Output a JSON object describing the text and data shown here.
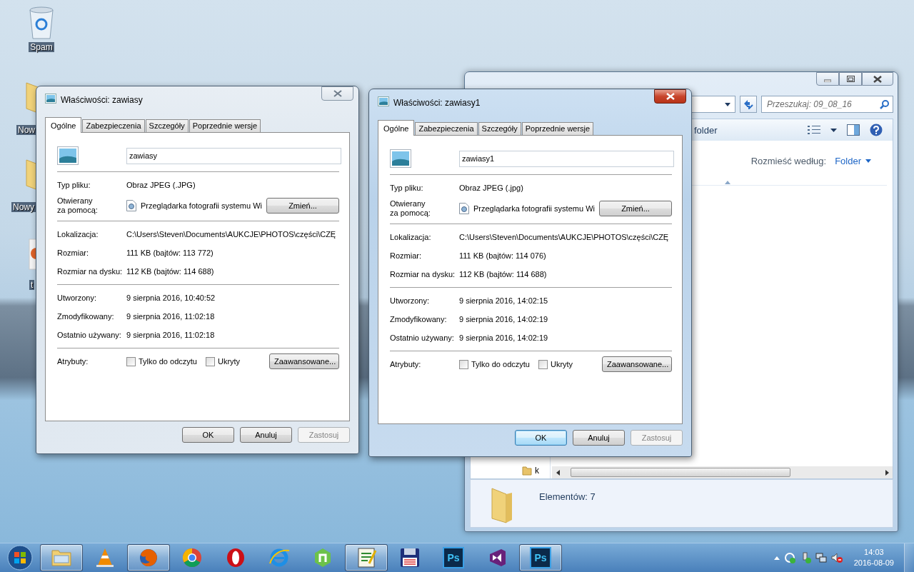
{
  "desktop_icons": [
    {
      "kind": "trash",
      "label": "Spam"
    },
    {
      "kind": "folder",
      "label": "Now"
    },
    {
      "kind": "folder",
      "label": "Nowy"
    },
    {
      "kind": "app",
      "label": "t"
    }
  ],
  "explorer": {
    "search": {
      "placeholder": "Przeszukaj: 09_08_16"
    },
    "toolbar_item": "folder",
    "arrange_label": "Rozmieść według:",
    "arrange_value": "Folder",
    "nav_item": "k",
    "status": "Elementów: 7"
  },
  "dialogs": [
    {
      "active": false,
      "title": "Właściwości: zawiasy",
      "tabs": [
        {
          "label": "Ogólne",
          "selected": true
        },
        {
          "label": "Zabezpieczenia",
          "selected": false
        },
        {
          "label": "Szczegóły",
          "selected": false
        },
        {
          "label": "Poprzednie wersje",
          "selected": false
        }
      ],
      "file_name": "zawiasy",
      "file_type": {
        "label": "Typ pliku:",
        "value": "Obraz JPEG (.JPG)"
      },
      "opens_with": {
        "label": "Otwierany\nza pomocą:",
        "value": "Przeglądarka fotografii systemu Wi",
        "button": "Zmień..."
      },
      "location_rows": [
        {
          "label": "Lokalizacja:",
          "value": "C:\\Users\\Steven\\Documents\\AUKCJE\\PHOTOS\\części\\CZĘ"
        },
        {
          "label": "Rozmiar:",
          "value": "111 KB (bajtów: 113 772)"
        },
        {
          "label": "Rozmiar na dysku:",
          "value": "112 KB (bajtów: 114 688)"
        }
      ],
      "date_rows": [
        {
          "label": "Utworzony:",
          "value": "9 sierpnia 2016, 10:40:52"
        },
        {
          "label": "Zmodyfikowany:",
          "value": "9 sierpnia 2016, 11:02:18"
        },
        {
          "label": "Ostatnio używany:",
          "value": "9 sierpnia 2016, 11:02:18"
        }
      ],
      "attributes": {
        "label": "Atrybuty:",
        "checkboxes": [
          {
            "label": "Tylko do odczytu",
            "checked": false
          },
          {
            "label": "Ukryty",
            "checked": false
          }
        ],
        "button": "Zaawansowane..."
      },
      "buttons": [
        {
          "label": "OK",
          "disabled": false,
          "focused": false
        },
        {
          "label": "Anuluj",
          "disabled": false,
          "focused": false
        },
        {
          "label": "Zastosuj",
          "disabled": true,
          "focused": false
        }
      ]
    },
    {
      "active": true,
      "title": "Właściwości: zawiasy1",
      "tabs": [
        {
          "label": "Ogólne",
          "selected": true
        },
        {
          "label": "Zabezpieczenia",
          "selected": false
        },
        {
          "label": "Szczegóły",
          "selected": false
        },
        {
          "label": "Poprzednie wersje",
          "selected": false
        }
      ],
      "file_name": "zawiasy1",
      "file_type": {
        "label": "Typ pliku:",
        "value": "Obraz JPEG (.jpg)"
      },
      "opens_with": {
        "label": "Otwierany\nza pomocą:",
        "value": "Przeglądarka fotografii systemu Wi",
        "button": "Zmień..."
      },
      "location_rows": [
        {
          "label": "Lokalizacja:",
          "value": "C:\\Users\\Steven\\Documents\\AUKCJE\\PHOTOS\\części\\CZĘ"
        },
        {
          "label": "Rozmiar:",
          "value": "111 KB (bajtów: 114 076)"
        },
        {
          "label": "Rozmiar na dysku:",
          "value": "112 KB (bajtów: 114 688)"
        }
      ],
      "date_rows": [
        {
          "label": "Utworzony:",
          "value": "9 sierpnia 2016, 14:02:15"
        },
        {
          "label": "Zmodyfikowany:",
          "value": "9 sierpnia 2016, 14:02:19"
        },
        {
          "label": "Ostatnio używany:",
          "value": "9 sierpnia 2016, 14:02:19"
        }
      ],
      "attributes": {
        "label": "Atrybuty:",
        "checkboxes": [
          {
            "label": "Tylko do odczytu",
            "checked": false
          },
          {
            "label": "Ukryty",
            "checked": false
          }
        ],
        "button": "Zaawansowane..."
      },
      "buttons": [
        {
          "label": "OK",
          "disabled": false,
          "focused": true
        },
        {
          "label": "Anuluj",
          "disabled": false,
          "focused": false
        },
        {
          "label": "Zastosuj",
          "disabled": true,
          "focused": false
        }
      ]
    }
  ],
  "taskbar": {
    "items": [
      {
        "kind": "explorer",
        "active": true
      },
      {
        "kind": "vlc",
        "active": false
      },
      {
        "kind": "firefox",
        "active": true
      },
      {
        "kind": "chrome",
        "active": false
      },
      {
        "kind": "opera",
        "active": false
      },
      {
        "kind": "ie",
        "active": false
      },
      {
        "kind": "node",
        "active": false
      },
      {
        "kind": "notepad",
        "active": true
      },
      {
        "kind": "floppy",
        "active": false
      },
      {
        "kind": "ps",
        "label": "Ps",
        "active": false
      },
      {
        "kind": "vs",
        "active": false
      },
      {
        "kind": "ps",
        "label": "Ps",
        "active": true
      }
    ],
    "time": "14:03",
    "date": "2016-08-09"
  }
}
